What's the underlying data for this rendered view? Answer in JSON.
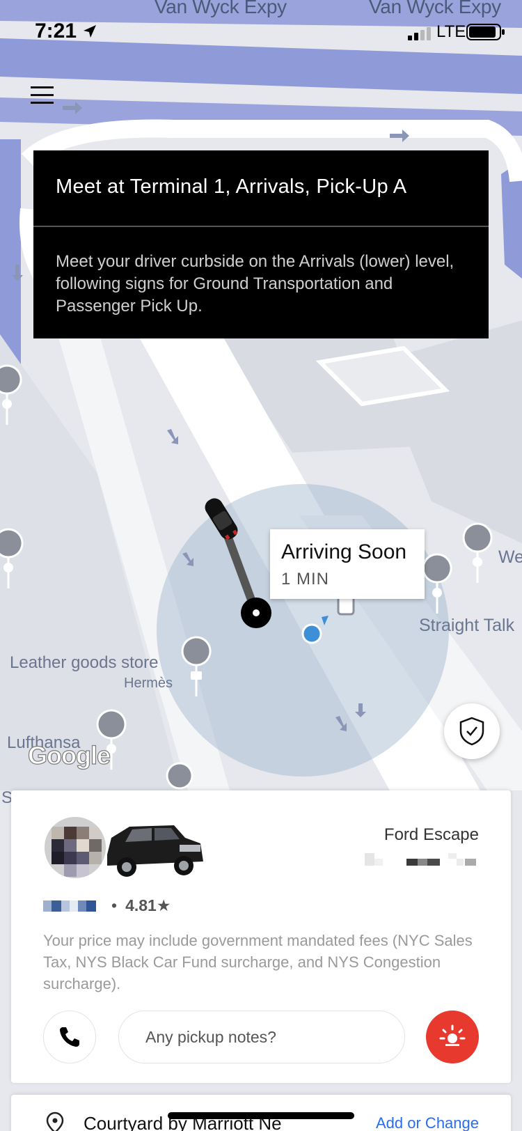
{
  "status_bar": {
    "time": "7:21",
    "network": "LTE"
  },
  "map": {
    "road_labels": [
      "Van Wyck Expy",
      "Van Wyck Expy"
    ],
    "poi_labels": [
      "Leather goods store",
      "Hermès",
      "Lufthansa",
      "Straight Talk",
      "We",
      "S"
    ],
    "attribution": "Google",
    "colors": {
      "highway": "#8f9ad8",
      "ground": "#e6e8ed",
      "pickup_zone": "#9fb5cf",
      "user_dot": "#3d8fd6"
    }
  },
  "pickup_info": {
    "title": "Meet at Terminal 1, Arrivals, Pick-Up A",
    "body": "Meet your driver curbside on the Arrivals (lower) level, following signs for Ground Transportation and Passenger Pick Up."
  },
  "arrival": {
    "title": "Arriving Soon",
    "eta": "1 MIN"
  },
  "driver": {
    "car_model": "Ford Escape",
    "rating": "4.81★",
    "separator": "•"
  },
  "fee_note": "Your price may include government mandated fees (NYC Sales Tax, NYS Black Car Fund surcharge, and NYS Congestion surcharge).",
  "actions": {
    "notes_placeholder": "Any pickup notes?",
    "alert_color": "#e8392f"
  },
  "destination": {
    "name": "Courtyard by Marriott Ne",
    "action": "Add or Change"
  },
  "icons": {
    "menu": "hamburger-icon",
    "nav": "location-arrow-icon",
    "safety": "shield-check-icon",
    "call": "phone-icon",
    "alert": "siren-icon",
    "destination": "location-pin-icon"
  }
}
